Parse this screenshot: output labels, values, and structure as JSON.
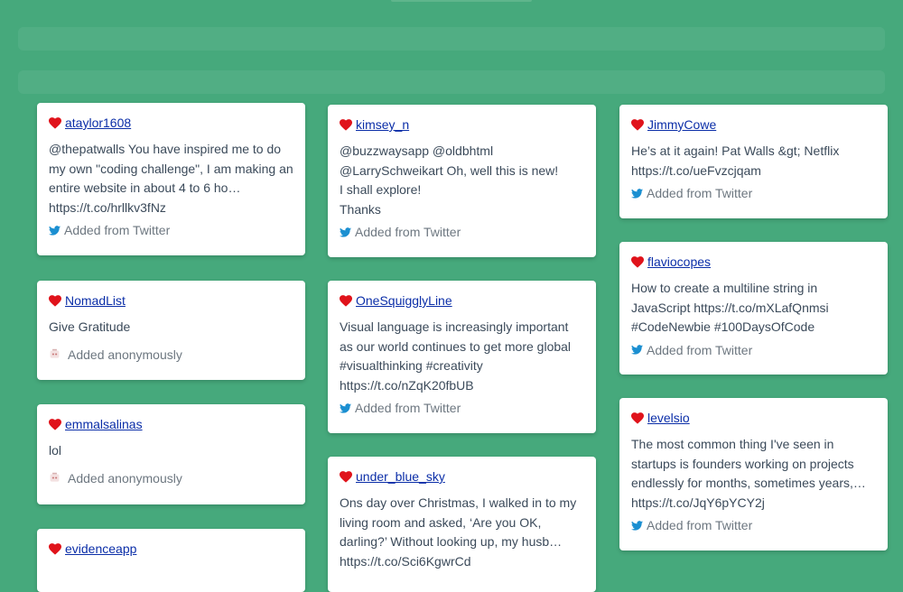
{
  "colors": {
    "background": "#46a97c",
    "heart": "#e0131b",
    "link": "#0b2ea8",
    "twitter": "#1da1f2"
  },
  "columns": [
    [
      {
        "user": "ataylor1608",
        "message": "@thepatwalls You have inspired me to do my own \"coding challenge\", I am making an entire website in about 4 to 6 ho… https://t.co/hrllkv3fNz",
        "source": "Added from Twitter",
        "source_icon": "twitter-icon"
      },
      {
        "user": "NomadList",
        "message": "Give Gratitude",
        "source": "Added anonymously",
        "source_icon": "anonymous-icon"
      },
      {
        "user": "emmalsalinas",
        "message": "lol",
        "source": "Added anonymously",
        "source_icon": "anonymous-icon"
      },
      {
        "user": "evidenceapp",
        "message": "",
        "source": "",
        "source_icon": ""
      }
    ],
    [
      {
        "user": "kimsey_n",
        "message": "@buzzwaysapp @oldbhtml @LarrySchweikart Oh, well this is new!\nI shall explore!\nThanks",
        "source": "Added from Twitter",
        "source_icon": "twitter-icon"
      },
      {
        "user": "OneSquigglyLine",
        "message": "Visual language is increasingly important as our world continues to get more global #visualthinking #creativity https://t.co/nZqK20fbUB",
        "source": "Added from Twitter",
        "source_icon": "twitter-icon"
      },
      {
        "user": "under_blue_sky",
        "message": "Ons day over Christmas, I walked in to my living room and asked, ‘Are you OK, darling?’ Without looking up, my husb… https://t.co/Sci6KgwrCd",
        "source": "",
        "source_icon": ""
      }
    ],
    [
      {
        "user": "JimmyCowe",
        "message": "He’s at it again! Pat Walls &gt; Netflix https://t.co/ueFvzcjqam",
        "source": "Added from Twitter",
        "source_icon": "twitter-icon"
      },
      {
        "user": "flaviocopes",
        "message": "How to create a multiline string in JavaScript https://t.co/mXLafQnmsi #CodeNewbie #100DaysOfCode",
        "source": "Added from Twitter",
        "source_icon": "twitter-icon"
      },
      {
        "user": "levelsio",
        "message": "The most common thing I've seen in startups is founders working on projects endlessly for months, sometimes years,… https://t.co/JqY6pYCY2j",
        "source": "Added from Twitter",
        "source_icon": "twitter-icon"
      }
    ]
  ]
}
